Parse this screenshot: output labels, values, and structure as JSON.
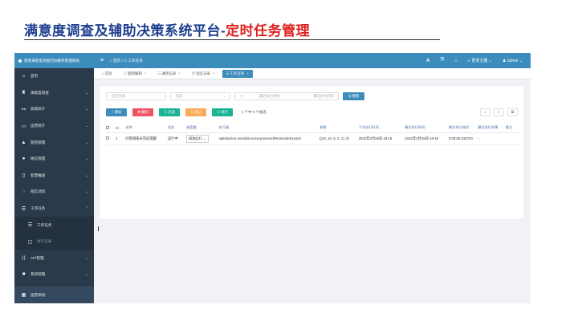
{
  "slide": {
    "title_main": "满意度调查及辅助决策系统平台-",
    "title_accent": "定时任务管理"
  },
  "app": {
    "sidebar": {
      "header": "患者满意度调查回访服务管理系统",
      "items": [
        {
          "label": "首页",
          "icon": "home-icon",
          "glyph": "⌂",
          "chev": ""
        },
        {
          "label": "满意度调查",
          "icon": "survey-icon",
          "glyph": "♜",
          "chev": "⌄"
        },
        {
          "label": "高级统计",
          "icon": "stats-icon",
          "glyph": "⚯",
          "chev": "⌄"
        },
        {
          "label": "运营统计",
          "icon": "monitor-icon",
          "glyph": "▭",
          "chev": "⌄"
        },
        {
          "label": "医院管理",
          "icon": "hospital-icon",
          "glyph": "▲",
          "chev": "⌄"
        },
        {
          "label": "微信管理",
          "icon": "wechat-icon",
          "glyph": "●",
          "chev": "⌄"
        },
        {
          "label": "智慧推送",
          "icon": "phone-icon",
          "glyph": "▯",
          "chev": "⌄"
        },
        {
          "label": "短信消息",
          "icon": "message-icon",
          "glyph": "◌",
          "chev": "⌄"
        },
        {
          "label": "工作任务",
          "icon": "list-icon",
          "glyph": "☰",
          "chev": "⌃"
        }
      ],
      "sub_items": [
        {
          "label": "工作任务",
          "icon": "list-icon",
          "glyph": "☰"
        },
        {
          "label": "执行记录",
          "icon": "bookmark-icon",
          "glyph": "▢"
        }
      ],
      "items2": [
        {
          "label": "API管理",
          "icon": "code-icon",
          "glyph": "⟨⟩",
          "chev": "⌄"
        },
        {
          "label": "系统管理",
          "icon": "square-icon",
          "glyph": "■",
          "chev": "⌄"
        }
      ],
      "bottom": {
        "label": "运营系统",
        "icon": "grid-icon",
        "glyph": "▦"
      }
    },
    "topbar": {
      "menu_glyph": "≡",
      "breadcrumb": "⌂ 首页  /  ☷ 工作任务",
      "icons": [
        {
          "name": "font-size-icon",
          "glyph": "A"
        },
        {
          "name": "fullscreen-icon",
          "glyph": "⤧"
        },
        {
          "name": "home-icon",
          "glyph": "⌂"
        }
      ],
      "theme": "◐ 更变主题 ⌄",
      "user": "♟ admin ⌄"
    },
    "tabs": [
      {
        "label": "⌂ 首页",
        "close": ""
      },
      {
        "label": "▽ 题目编制",
        "close": "×"
      },
      {
        "label": "☷ 通话记录",
        "close": "×"
      },
      {
        "label": "☏ 短信记录",
        "close": "×"
      },
      {
        "label": "☰ 工作任务",
        "close": "×",
        "active": true
      }
    ],
    "filters": {
      "name_placeholder": "任务名称",
      "status_placeholder": "状态",
      "start_placeholder": "最近执行开始",
      "end_placeholder": "最近执行结束",
      "search_label": "Q 搜索"
    },
    "actions": {
      "add": "+ 增加",
      "delete": "✖ 删除",
      "start": "⊙ 启动",
      "stop": "⊙ 停止",
      "run": "⊙ 执行",
      "selected": "1 个中 0 个被选"
    },
    "tool_glyphs": [
      "⌕",
      "⌕",
      "⧉"
    ],
    "table": {
      "headers": [
        "",
        "ID",
        "名称",
        "状态",
        "调度器",
        "执行器",
        "参数",
        "下次执行时间",
        "最近执行时间",
        "最近执行耗时",
        "最近执行结果",
        "备注"
      ],
      "rows": [
        {
          "id": "1",
          "name": "问卷调查未完成提醒",
          "status": "运行中",
          "scheduler": "周期运行",
          "executor": "satisfaction.reminder.surveyUnreachReminderExcutor",
          "params": "((10, 10, 6, 3, 1), 0)",
          "next_time": "2022年2月26日 19:18",
          "last_time": "2022年2月26日 19:18",
          "duration": "0:00:00.010740",
          "result": "-",
          "remark": ""
        }
      ]
    }
  }
}
